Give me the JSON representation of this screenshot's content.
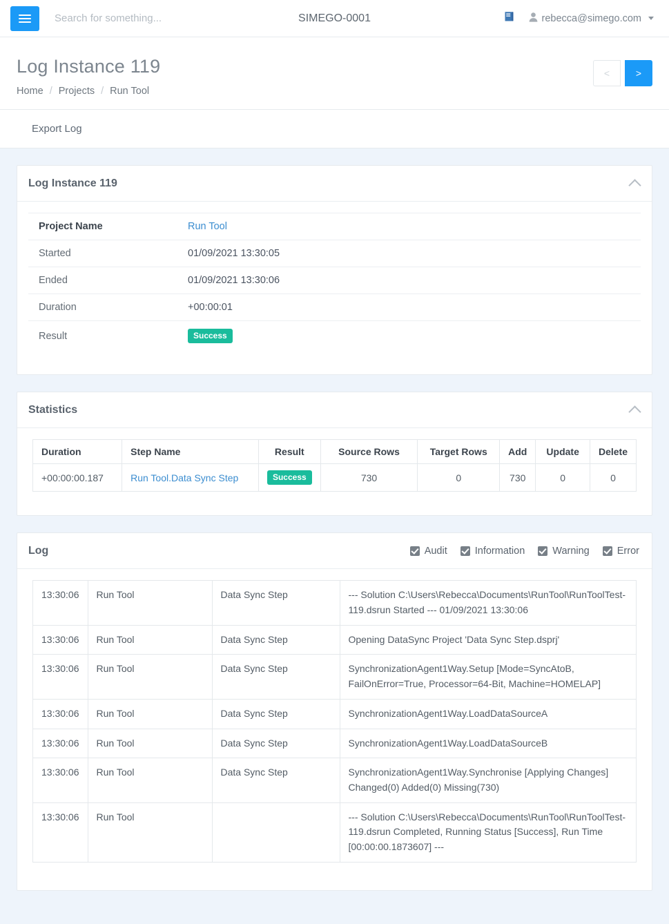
{
  "navbar": {
    "menu_icon": "hamburger-icon",
    "search_placeholder": "Search for something...",
    "search_value": "",
    "center_title": "SIMEGO-0001",
    "book_icon": "book-icon",
    "user_icon": "user-icon",
    "user_email": "rebecca@simego.com",
    "caret_icon": "chevron-down-icon"
  },
  "page_header": {
    "title": "Log Instance 119",
    "breadcrumb": [
      {
        "label": "Home"
      },
      {
        "label": "Projects"
      },
      {
        "label": "Run Tool"
      }
    ],
    "separator": "/",
    "pager": {
      "prev_label": "<",
      "next_label": ">"
    }
  },
  "toolbar": {
    "export_log_label": "Export Log"
  },
  "cards": {
    "instance": {
      "title": "Log Instance 119",
      "collapse_icon": "chevron-up-icon",
      "rows": [
        {
          "label": "Project Name",
          "value": "Run Tool",
          "type": "link",
          "bold": true
        },
        {
          "label": "Started",
          "value": "01/09/2021 13:30:05",
          "type": "text",
          "bold": false
        },
        {
          "label": "Ended",
          "value": "01/09/2021 13:30:06",
          "type": "text",
          "bold": false
        },
        {
          "label": "Duration",
          "value": "+00:00:01",
          "type": "text",
          "bold": false
        },
        {
          "label": "Result",
          "value": "Success",
          "type": "badge",
          "bold": false
        }
      ]
    },
    "statistics": {
      "title": "Statistics",
      "collapse_icon": "chevron-up-icon",
      "columns": [
        "Duration",
        "Step Name",
        "Result",
        "Source Rows",
        "Target Rows",
        "Add",
        "Update",
        "Delete"
      ],
      "rows": [
        {
          "duration": "+00:00:00.187",
          "step_name": "Run Tool.Data Sync Step",
          "result": "Success",
          "source_rows": "730",
          "target_rows": "0",
          "add": "730",
          "update": "0",
          "delete": "0"
        }
      ]
    },
    "log": {
      "title": "Log",
      "filters": [
        {
          "label": "Audit",
          "checked": true
        },
        {
          "label": "Information",
          "checked": true
        },
        {
          "label": "Warning",
          "checked": true
        },
        {
          "label": "Error",
          "checked": true
        }
      ],
      "rows": [
        {
          "time": "13:30:06",
          "project": "Run Tool",
          "step": "Data Sync Step",
          "message": "--- Solution C:\\Users\\Rebecca\\Documents\\RunTool\\RunToolTest-119.dsrun Started --- 01/09/2021 13:30:06"
        },
        {
          "time": "13:30:06",
          "project": "Run Tool",
          "step": "Data Sync Step",
          "message": "Opening DataSync Project 'Data Sync Step.dsprj'"
        },
        {
          "time": "13:30:06",
          "project": "Run Tool",
          "step": "Data Sync Step",
          "message": "SynchronizationAgent1Way.Setup [Mode=SyncAtoB, FailOnError=True, Processor=64-Bit, Machine=HOMELAP]"
        },
        {
          "time": "13:30:06",
          "project": "Run Tool",
          "step": "Data Sync Step",
          "message": "SynchronizationAgent1Way.LoadDataSourceA"
        },
        {
          "time": "13:30:06",
          "project": "Run Tool",
          "step": "Data Sync Step",
          "message": "SynchronizationAgent1Way.LoadDataSourceB"
        },
        {
          "time": "13:30:06",
          "project": "Run Tool",
          "step": "Data Sync Step",
          "message": "SynchronizationAgent1Way.Synchronise [Applying Changes] Changed(0) Added(0) Missing(730)"
        },
        {
          "time": "13:30:06",
          "project": "Run Tool",
          "step": "",
          "message": "--- Solution C:\\Users\\Rebecca\\Documents\\RunTool\\RunToolTest-119.dsrun Completed, Running Status [Success], Run Time [00:00:00.1873607] ---"
        }
      ]
    }
  },
  "colors": {
    "accent_blue": "#1b9af7",
    "success_green": "#1abc9c",
    "page_background": "#eef4fb",
    "link_blue": "#3b8dd0"
  }
}
